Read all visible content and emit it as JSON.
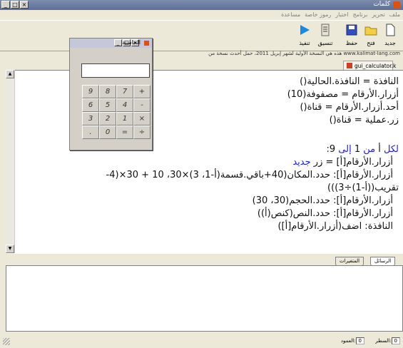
{
  "app": {
    "title": "كلمات"
  },
  "menu": [
    "ملف",
    "تحرير",
    "برنامج",
    "اختبار",
    "رموز خاصة",
    "مساعدة"
  ],
  "toolbar": {
    "buttons": [
      {
        "label": "جديد",
        "icon": "new-file-icon"
      },
      {
        "label": "فتح",
        "icon": "open-folder-icon"
      },
      {
        "label": "حفظ",
        "icon": "save-icon"
      },
      {
        "label": "تنسيق",
        "icon": "format-icon"
      },
      {
        "label": "تنفيذ",
        "icon": "run-icon"
      }
    ]
  },
  "notice": "هذه هي النسخة الأولية لشهر إبريل 2011، حمل أحدث نسخة من www.kalimat-lang.com",
  "file_tab": "gui_calculator.k",
  "code_lines": [
    {
      "text": "النافذة = النافذة.الحالية()"
    },
    {
      "text": "أزرار.الأرقام = مصفوفة(10)"
    },
    {
      "text": "أحد.أزرار.الأرقام = قناة()"
    },
    {
      "text": "زر.عملية = قناة()"
    },
    {
      "text": ""
    },
    {
      "parts": [
        {
          "t": "لكل ",
          "k": true
        },
        {
          "t": "أ "
        },
        {
          "t": "من ",
          "k": true
        },
        {
          "t": "1 "
        },
        {
          "t": "إلى ",
          "k": true
        },
        {
          "t": "9:"
        }
      ]
    },
    {
      "parts": [
        {
          "t": "أزرار.الأرقام[أ] = زر "
        },
        {
          "t": "جديد",
          "k": true
        }
      ]
    },
    {
      "text": "أزرار.الأرقام[أ]: حدد.المكان(40+باقي.قسمة(أ-1، 3)×30، 10 + 30×(4-"
    },
    {
      "text": "تقريب((أ-1)÷3)))"
    },
    {
      "text": "أزرار.الأرقام[أ]: حدد.الحجم(30، 30)"
    },
    {
      "text": "أزرار.الأرقام[أ]: حدد.النص(كنص(أ))"
    },
    {
      "text": "النافذة: اضف(أزرار.الأرقام[أ])"
    }
  ],
  "calculator": {
    "title": "الحاسبة",
    "keys": [
      "9",
      "8",
      "7",
      "+",
      "6",
      "5",
      "4",
      "-",
      "3",
      "2",
      "1",
      "×",
      ".",
      "0",
      "=",
      "÷"
    ]
  },
  "bottom_tabs": [
    "الرسائل",
    "المتغيرات"
  ],
  "status": {
    "row_label": "السطر:",
    "row_value": "0",
    "col_label": "العمود:",
    "col_value": "0"
  }
}
